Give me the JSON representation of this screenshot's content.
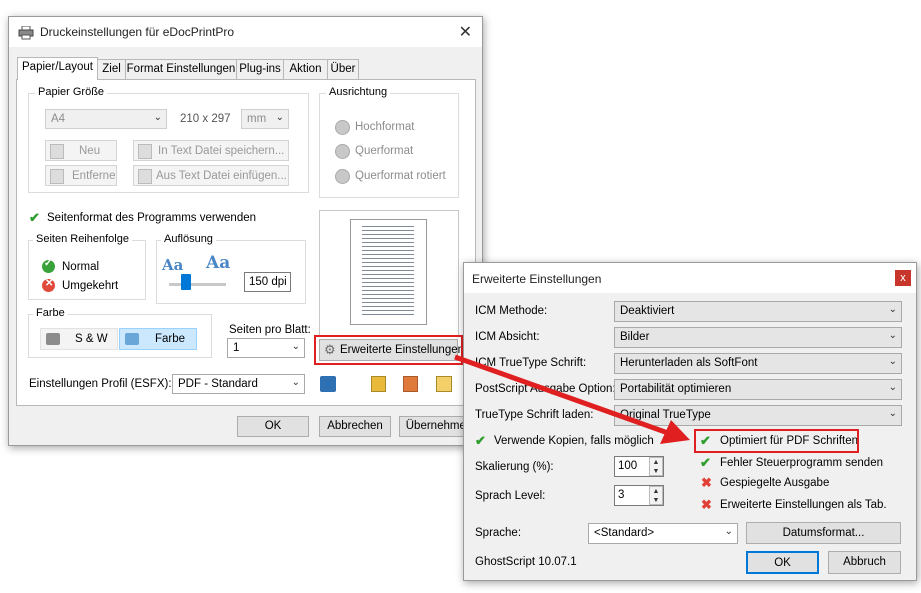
{
  "main_window": {
    "title": "Druckeinstellungen für eDocPrintPro",
    "tabs": [
      "Papier/Layout",
      "Ziel",
      "Format Einstellungen",
      "Plug-ins",
      "Aktion",
      "Über"
    ],
    "paper": {
      "group_label": "Papier Größe",
      "size_value": "A4",
      "dimensions": "210 x 297",
      "unit": "mm",
      "new_label": "Neu",
      "remove_label": "Entferne",
      "save_text_label": "In Text Datei speichern...",
      "paste_text_label": "Aus Text Datei einfügen..."
    },
    "orientation": {
      "group_label": "Ausrichtung",
      "portrait": "Hochformat",
      "landscape": "Querformat",
      "landscape_rotated": "Querformat rotiert"
    },
    "use_program_format": "Seitenformat des Programms verwenden",
    "page_order": {
      "group_label": "Seiten Reihenfolge",
      "normal": "Normal",
      "reverse": "Umgekehrt"
    },
    "resolution": {
      "group_label": "Auflösung",
      "value": "150 dpi",
      "glyph": "Aa"
    },
    "color": {
      "group_label": "Farbe",
      "bw": "S & W",
      "color": "Farbe"
    },
    "pages_per_sheet": {
      "label": "Seiten pro Blatt:",
      "value": "1"
    },
    "advanced_button": "Erweiterte Einstellungen",
    "profile": {
      "label": "Einstellungen Profil (ESFX):",
      "value": "PDF - Standard"
    },
    "ok": "OK",
    "cancel": "Abbrechen",
    "apply": "Übernehmen"
  },
  "advanced_dialog": {
    "title": "Erweiterte Einstellungen",
    "rows": [
      {
        "label": "ICM Methode:",
        "value": "Deaktiviert"
      },
      {
        "label": "ICM Absicht:",
        "value": "Bilder"
      },
      {
        "label": "ICM TrueType Schrift:",
        "value": "Herunterladen als SoftFont"
      },
      {
        "label": "PostScript Ausgabe Option:",
        "value": "Portabilität optimieren"
      },
      {
        "label": "TrueType Schrift laden:",
        "value": "Original TrueType"
      }
    ],
    "use_copies": "Verwende Kopien, falls möglich",
    "scaling": {
      "label": "Skalierung (%):",
      "value": "100"
    },
    "language_level": {
      "label": "Sprach Level:",
      "value": "3"
    },
    "options": [
      {
        "label": "Optimiert für PDF Schriften",
        "state": "on"
      },
      {
        "label": "Fehler Steuerprogramm senden",
        "state": "on"
      },
      {
        "label": "Gespiegelte Ausgabe",
        "state": "off"
      },
      {
        "label": "Erweiterte Einstellungen als Tab.",
        "state": "off"
      }
    ],
    "language": {
      "label": "Sprache:",
      "value": "<Standard>"
    },
    "date_format": "Datumsformat...",
    "ghostscript": "GhostScript 10.07.1",
    "ok": "OK",
    "cancel": "Abbruch"
  },
  "colors": {
    "highlight": "#e02020",
    "accent": "#0078d7",
    "check": "#2f9e2f",
    "cross": "#e04036"
  }
}
